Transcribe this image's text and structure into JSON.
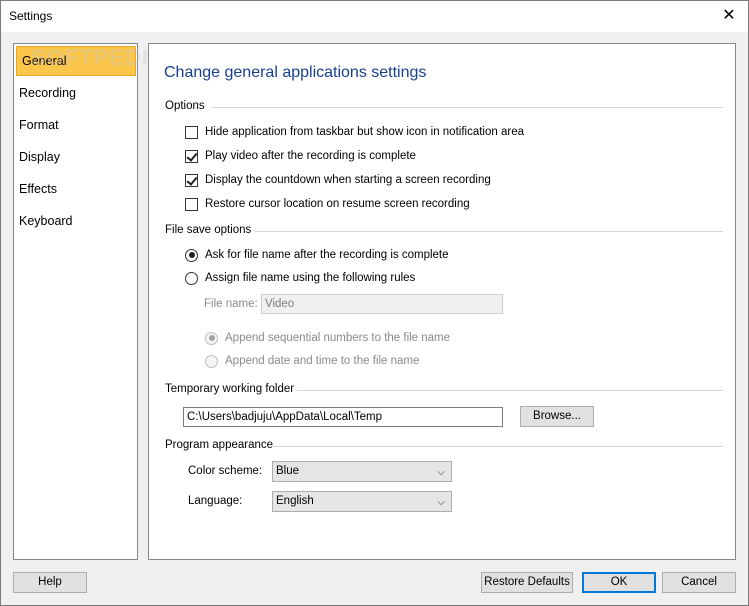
{
  "window": {
    "title": "Settings",
    "close_glyph": "✕"
  },
  "sidebar": {
    "items": [
      {
        "label": "General",
        "active": true
      },
      {
        "label": "Recording"
      },
      {
        "label": "Format"
      },
      {
        "label": "Display"
      },
      {
        "label": "Effects"
      },
      {
        "label": "Keyboard"
      }
    ]
  },
  "watermark": "SOFTPEDIA",
  "main": {
    "title": "Change general applications settings",
    "options": {
      "label": "Options",
      "items": [
        {
          "label": "Hide application from taskbar but show icon in notification area",
          "checked": false
        },
        {
          "label": "Play video after the recording is complete",
          "checked": true
        },
        {
          "label": "Display the countdown when starting a screen recording",
          "checked": true
        },
        {
          "label": "Restore cursor location on resume screen recording",
          "checked": false
        }
      ]
    },
    "file_save": {
      "label": "File save options",
      "ask_label": "Ask for file name after the recording is complete",
      "assign_label": "Assign file name using the following rules",
      "file_name_label": "File name:",
      "file_name_value": "Video",
      "append_seq_label": "Append sequential numbers to the file name",
      "append_date_label": "Append date and time to the file name"
    },
    "temp_folder": {
      "label": "Temporary working folder",
      "path": "C:\\Users\\badjuju\\AppData\\Local\\Temp",
      "browse_label": "Browse..."
    },
    "appearance": {
      "label": "Program appearance",
      "color_scheme_label": "Color scheme:",
      "color_scheme_value": "Blue",
      "language_label": "Language:",
      "language_value": "English",
      "chevron_glyph": "⌵"
    }
  },
  "footer": {
    "help_label": "Help",
    "restore_label": "Restore Defaults",
    "ok_label": "OK",
    "cancel_label": "Cancel"
  },
  "colors": {
    "active_nav": "#fcc64a",
    "title_blue": "#1a3f8f",
    "default_button_border": "#0078d7"
  }
}
